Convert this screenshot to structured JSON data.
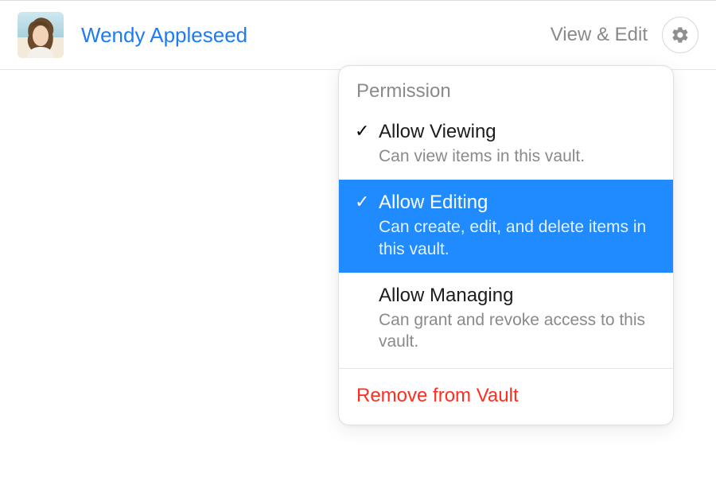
{
  "user": {
    "name": "Wendy Appleseed",
    "permission_summary": "View & Edit"
  },
  "popover": {
    "header": "Permission",
    "items": [
      {
        "title": "Allow Viewing",
        "description": "Can view items in this vault.",
        "checked": true,
        "selected": false
      },
      {
        "title": "Allow Editing",
        "description": "Can create, edit, and delete items in this vault.",
        "checked": true,
        "selected": true
      },
      {
        "title": "Allow Managing",
        "description": "Can grant and revoke access to this vault.",
        "checked": false,
        "selected": false
      }
    ],
    "remove_label": "Remove from Vault"
  },
  "icons": {
    "check": "✓"
  }
}
